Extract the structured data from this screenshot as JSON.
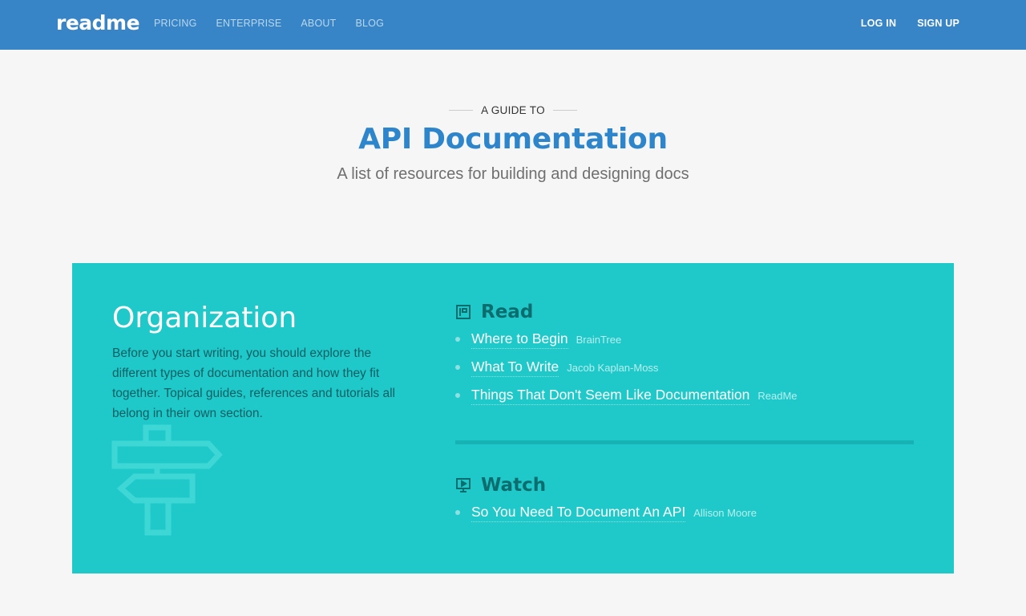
{
  "header": {
    "logo": "readme",
    "nav": [
      "PRICING",
      "ENTERPRISE",
      "ABOUT",
      "BLOG"
    ],
    "auth": {
      "login": "LOG IN",
      "signup": "SIGN UP"
    }
  },
  "hero": {
    "eyebrow": "A GUIDE TO",
    "title": "API Documentation",
    "subtitle": "A list of resources for building and designing docs"
  },
  "panel": {
    "title": "Organization",
    "description": "Before you start writing, you should explore the different types of documentation and how they fit together. Topical guides, references and tutorials all belong in their own section.",
    "read": {
      "heading": "Read",
      "items": [
        {
          "title": "Where to Begin",
          "author": "BrainTree"
        },
        {
          "title": "What To Write",
          "author": "Jacob Kaplan-Moss"
        },
        {
          "title": "Things That Don't Seem Like Documentation",
          "author": "ReadMe"
        }
      ]
    },
    "watch": {
      "heading": "Watch",
      "items": [
        {
          "title": "So You Need To Document An API",
          "author": "Allison Moore"
        }
      ]
    }
  },
  "colors": {
    "header_bg": "#3784c7",
    "title_blue": "#2d85cb",
    "panel_bg": "#1fc9c9",
    "panel_heading": "#0d6c6e"
  }
}
